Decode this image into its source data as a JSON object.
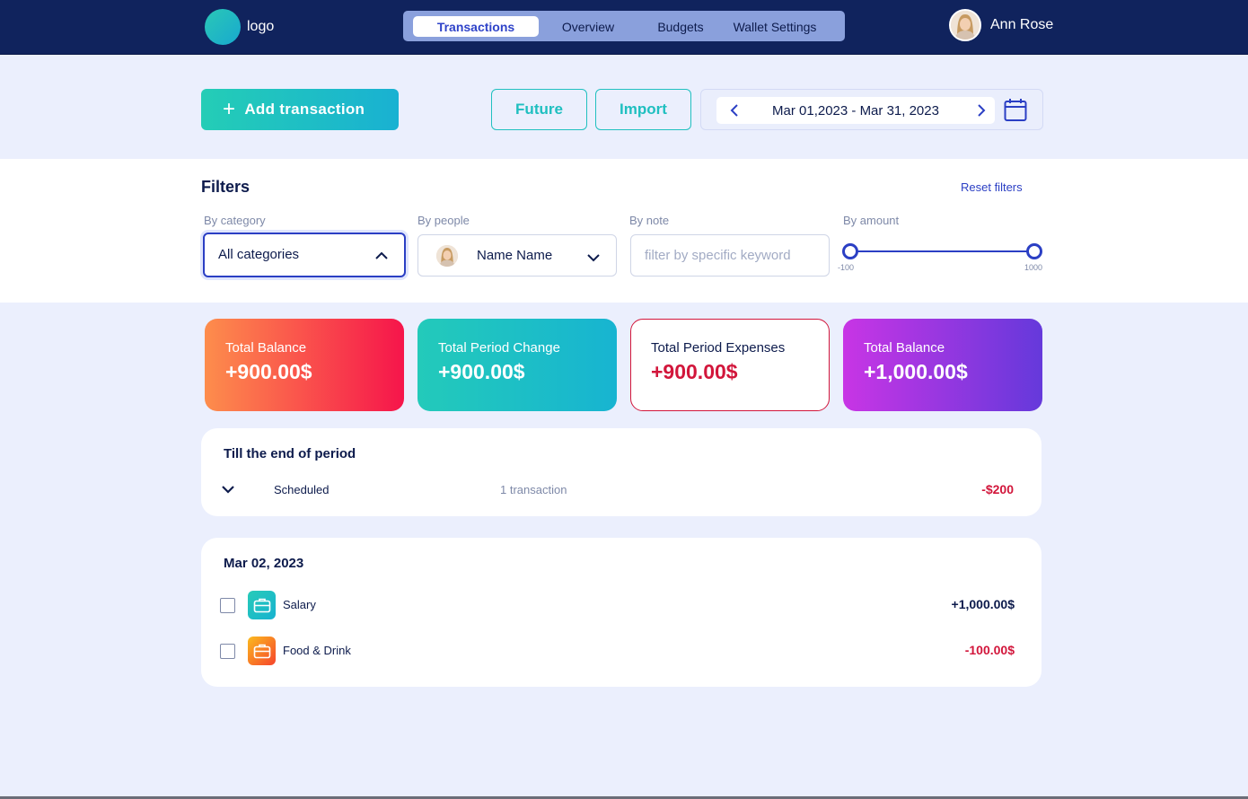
{
  "header": {
    "logo_text": "logo",
    "tabs": [
      {
        "label": "Transactions",
        "active": true
      },
      {
        "label": "Overview",
        "active": false
      },
      {
        "label": "Budgets",
        "active": false
      },
      {
        "label": "Wallet Settings",
        "active": false
      }
    ],
    "user_name": "Ann Rose"
  },
  "actions": {
    "add_label": "Add transaction",
    "future_label": "Future",
    "import_label": "Import",
    "date_range": "Mar 01,2023 - Mar 31, 2023"
  },
  "filters": {
    "title": "Filters",
    "reset_label": "Reset filters",
    "category": {
      "label": "By category",
      "value": "All categories"
    },
    "people": {
      "label": "By people",
      "value": "Name Name"
    },
    "note": {
      "label": "By note",
      "placeholder": "filter by specific keyword"
    },
    "amount": {
      "label": "By amount",
      "min": "-100",
      "max": "1000"
    }
  },
  "summary": [
    {
      "label": "Total Balance",
      "value": "+900.00$"
    },
    {
      "label": "Total Period Change",
      "value": "+900.00$"
    },
    {
      "label": "Total Period Expenses",
      "value": "+900.00$"
    },
    {
      "label": "Total Balance",
      "value": "+1,000.00$"
    }
  ],
  "scheduled": {
    "title": "Till the end of period",
    "label": "Scheduled",
    "count": "1 transaction",
    "amount": "-$200"
  },
  "day_group": {
    "date": "Mar 02, 2023",
    "transactions": [
      {
        "name": "Salary",
        "amount": "+1,000.00$",
        "icon": "briefcase-icon"
      },
      {
        "name": "Food & Drink",
        "amount": "-100.00$",
        "icon": "briefcase-icon"
      }
    ]
  },
  "colors": {
    "nav_bg": "#10235d",
    "accent_blue": "#2b3fc4",
    "teal": "#1fbfc0",
    "negative_red": "#d2163b",
    "page_bg": "#ebeffd"
  }
}
